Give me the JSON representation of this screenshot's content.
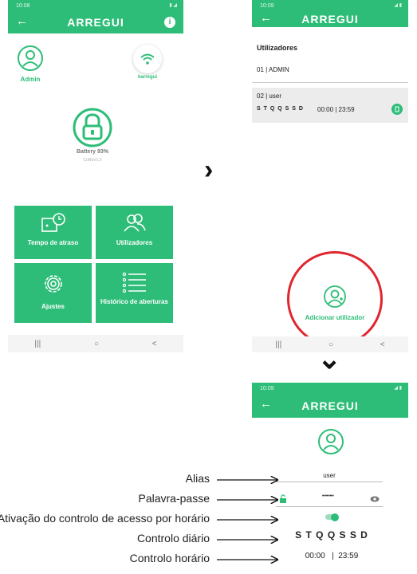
{
  "screen1": {
    "time": "10:08",
    "brand": "ARREGUI",
    "user_label": "Admin",
    "wifi_label": "barregui",
    "battery": "Battery 93%",
    "firmware": "CoRoV1.2",
    "tiles": [
      "Tempo de atraso",
      "Utilizadores",
      "Ajustes",
      "Histórico de aberturas"
    ]
  },
  "screen2": {
    "time": "10:09",
    "brand": "ARREGUI",
    "section_title": "Utilizadores",
    "users": [
      {
        "line": "01 | ADMIN"
      },
      {
        "line": "02 | user",
        "days": "S T Q Q S S D",
        "hours": "00:00 | 23:59"
      }
    ],
    "add_user_label": "Adicionar utilizador"
  },
  "screen3": {
    "time": "10:09",
    "brand": "ARREGUI",
    "alias_value": "user",
    "password_value": "••••••",
    "days": "S T Q Q S S D",
    "hours": "00:00   |  23:59"
  },
  "annotations": [
    "Alias",
    "Palavra-passe",
    "Ativação do controlo de acesso por horário",
    "Controlo diário",
    "Controlo horário"
  ],
  "colors": {
    "accent": "#2ebd78",
    "highlight": "#e0262e"
  },
  "nav_glyphs": [
    "|||",
    "○",
    "<"
  ],
  "arrows": {
    "right": "›",
    "down": "⌄"
  }
}
